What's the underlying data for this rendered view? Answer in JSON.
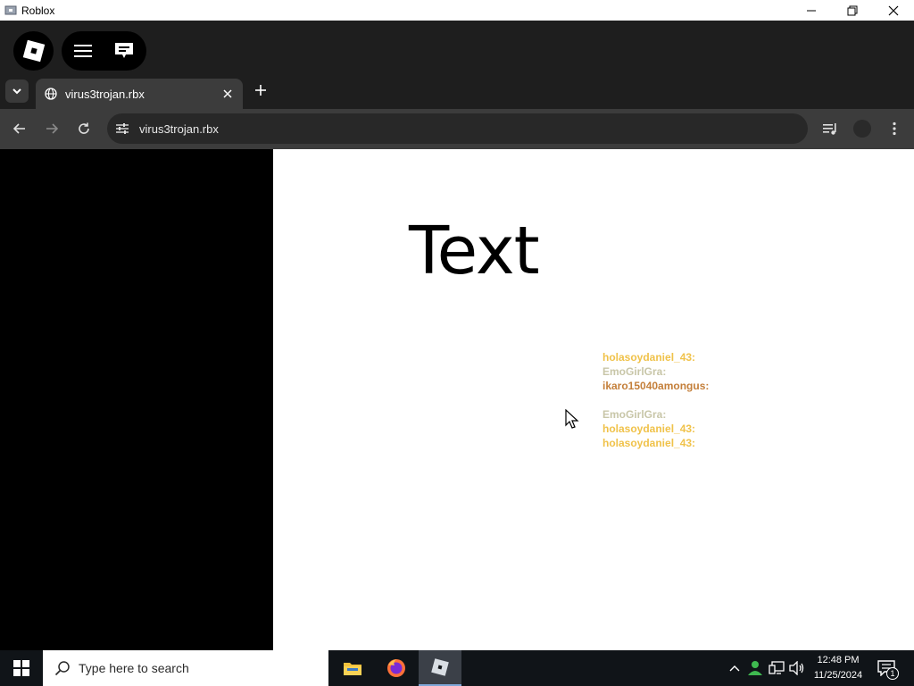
{
  "window": {
    "title": "Roblox",
    "minimize_glyph": "─",
    "maximize_glyph": "❐",
    "close_glyph": "✕"
  },
  "roblox_bar": {
    "logo_icon": "roblox-logo-icon",
    "menu_icon": "hamburger-menu-icon",
    "chat_icon": "chat-bubble-icon"
  },
  "browser": {
    "tab": {
      "title": "virus3trojan.rbx",
      "icon": "globe-icon"
    },
    "address": {
      "url": "virus3trojan.rbx"
    }
  },
  "content": {
    "big_text": "Text",
    "chat": [
      {
        "text": "holasoydaniel_43:",
        "color": "#f0c24a"
      },
      {
        "text": "EmoGirlGra:",
        "color": "#c8c6a8"
      },
      {
        "text": "ikaro15040amongus:",
        "color": "#c47f3a"
      },
      {
        "text": "",
        "color": "#000000"
      },
      {
        "text": "EmoGirlGra:",
        "color": "#c8c6a8"
      },
      {
        "text": "holasoydaniel_43:",
        "color": "#f0c24a"
      },
      {
        "text": "holasoydaniel_43:",
        "color": "#f0c24a"
      }
    ]
  },
  "taskbar": {
    "search_placeholder": "Type here to search",
    "apps": [
      "file-explorer-icon",
      "firefox-icon",
      "roblox-icon"
    ],
    "time": "12:48 PM",
    "date": "11/25/2024",
    "notification_count": "1"
  }
}
